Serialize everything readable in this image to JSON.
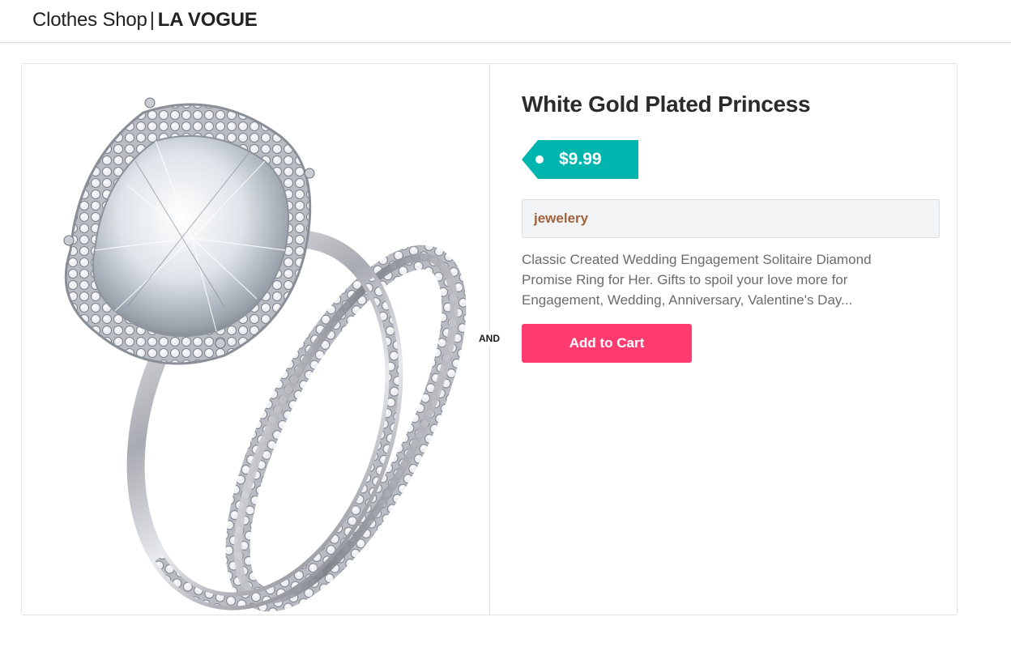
{
  "header": {
    "shop_name": "Clothes Shop",
    "separator": "|",
    "brand": "LA VOGUE"
  },
  "product": {
    "title": "White Gold Plated Princess",
    "price": "$9.99",
    "category": "jewelery",
    "description": "Classic Created Wedding Engagement Solitaire Diamond Promise Ring for Her. Gifts to spoil your love more for Engagement, Wedding, Anniversary, Valentine's Day...",
    "divider_label": "AND",
    "add_to_cart_label": "Add to Cart",
    "image_subject": "ring-set-image"
  },
  "colors": {
    "price_tag": "#00b5ad",
    "category_text": "#a0613b",
    "add_to_cart": "#ff3b6f",
    "title": "#2b2b2b"
  }
}
